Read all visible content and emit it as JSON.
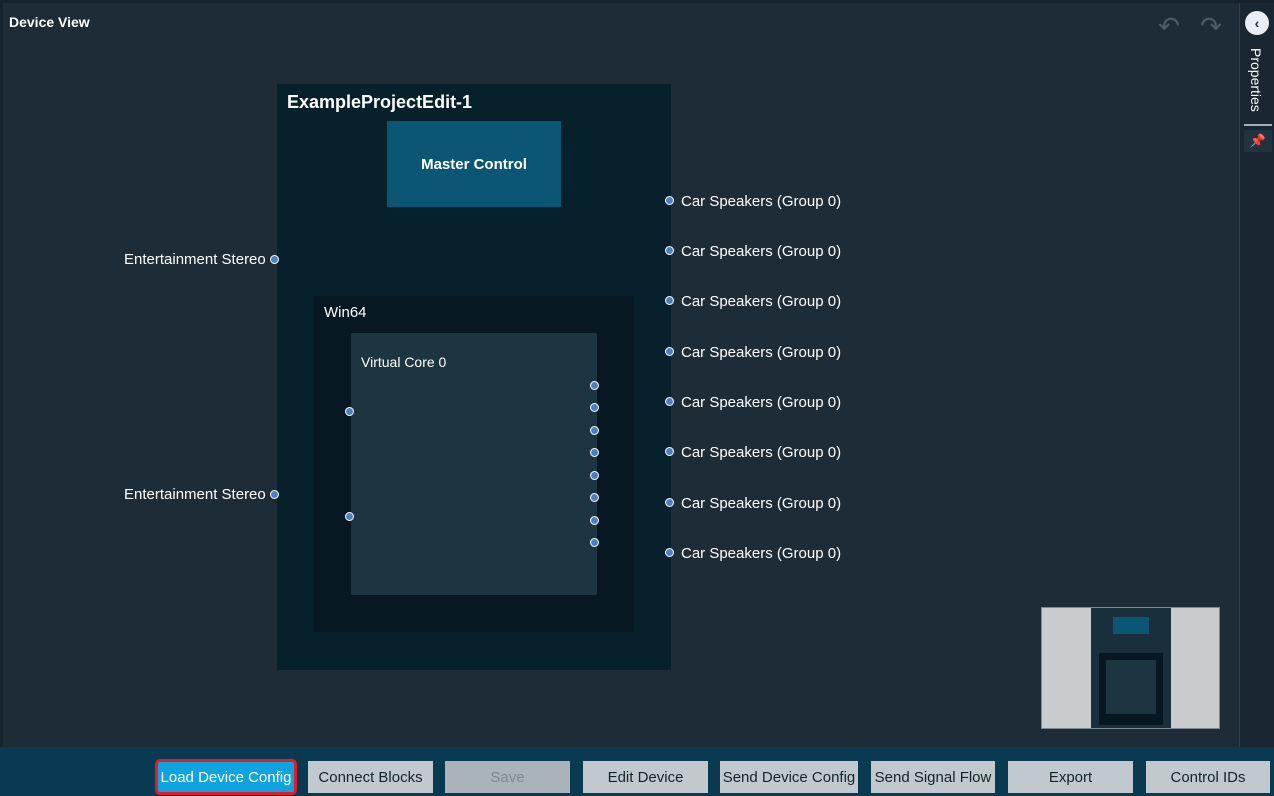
{
  "header": {
    "title": "Device View"
  },
  "right_panel": {
    "tab_label": "Properties"
  },
  "canvas": {
    "device_title": "ExampleProjectEdit-1",
    "master_control": "Master Control",
    "win_title": "Win64",
    "core_title": "Virtual Core 0",
    "inputs": [
      "Entertainment Stereo",
      "Entertainment Stereo"
    ],
    "outputs": [
      "Car Speakers (Group 0)",
      "Car Speakers (Group 0)",
      "Car Speakers (Group 0)",
      "Car Speakers (Group 0)",
      "Car Speakers (Group 0)",
      "Car Speakers (Group 0)",
      "Car Speakers (Group 0)",
      "Car Speakers (Group 0)"
    ]
  },
  "toolbar": {
    "load": "Load Device Config",
    "connect": "Connect Blocks",
    "save": "Save",
    "edit": "Edit Device",
    "send_config": "Send Device Config",
    "send_flow": "Send Signal Flow",
    "export": "Export",
    "control_ids": "Control IDs"
  },
  "colors": {
    "background": "#1e2c38",
    "device": "#06202c",
    "master": "#0b5575",
    "active_button": "#0fa3e0",
    "highlight": "#e21d2b"
  }
}
